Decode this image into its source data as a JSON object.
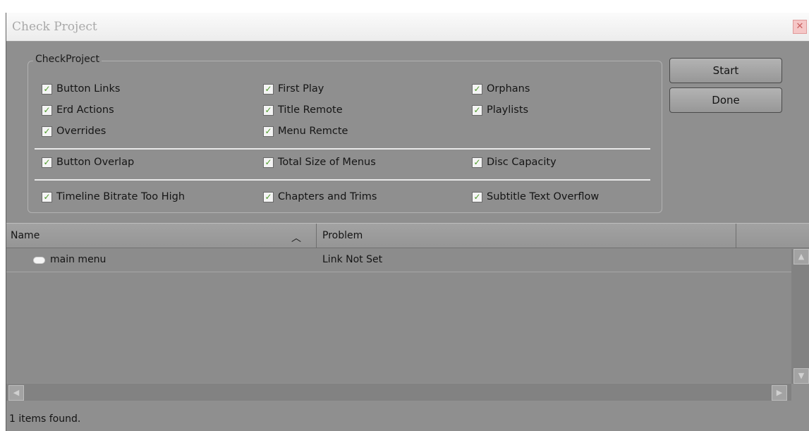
{
  "window": {
    "title": "Check Project",
    "close_glyph": "✕"
  },
  "group": {
    "legend": "CheckProject"
  },
  "checkboxes": [
    {
      "label": "Button Links",
      "checked": true
    },
    {
      "label": "First Play",
      "checked": true
    },
    {
      "label": "Orphans",
      "checked": true
    },
    {
      "label": "Erd Actions",
      "checked": true
    },
    {
      "label": "Title Remote",
      "checked": true
    },
    {
      "label": "Playlists",
      "checked": true
    },
    {
      "label": "Overrides",
      "checked": true
    },
    {
      "label": "Menu Remcte",
      "checked": true
    },
    {
      "label": "Button Overlap",
      "checked": true
    },
    {
      "label": "Total Size of Menus",
      "checked": true
    },
    {
      "label": "Disc Capacity",
      "checked": true
    },
    {
      "label": "Timeline Bitrate Too High",
      "checked": true
    },
    {
      "label": "Chapters and Trims",
      "checked": true
    },
    {
      "label": "Subtitle Text Overflow",
      "checked": true
    }
  ],
  "check_glyph": "✓",
  "buttons": {
    "start": "Start",
    "done": "Done"
  },
  "table": {
    "columns": [
      "Name",
      "Problem"
    ],
    "sort_glyph": "︿",
    "rows": [
      {
        "name": "main menu",
        "problem": "Link Not Set"
      }
    ]
  },
  "scroll_glyphs": {
    "up": "▲",
    "down": "▼",
    "left": "◀",
    "right": "▶"
  },
  "status": "1 items found."
}
